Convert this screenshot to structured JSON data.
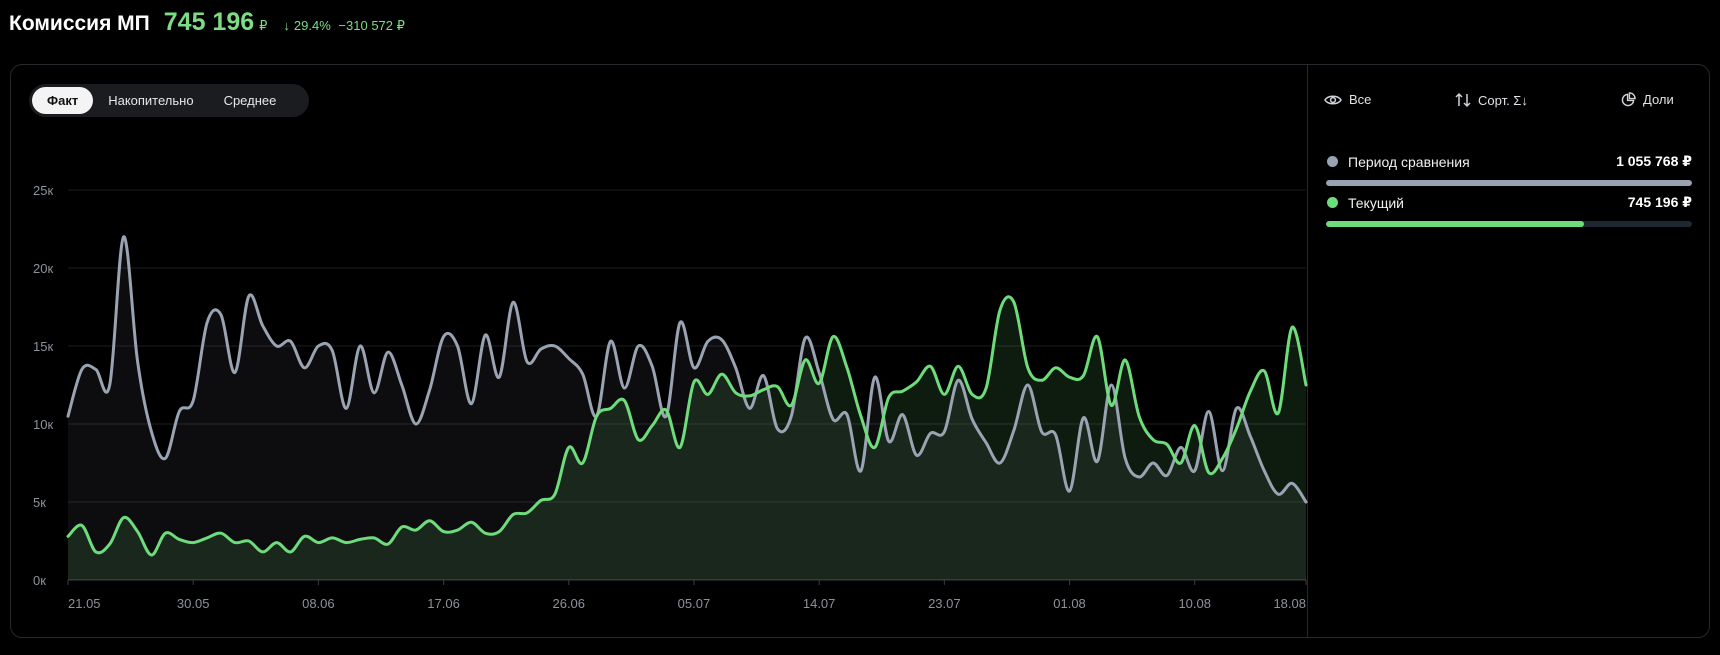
{
  "header": {
    "title": "Комиссия МП",
    "value": "745 196",
    "currency": "₽",
    "delta_percent": "29.4%",
    "delta_abs": "−310 572 ₽"
  },
  "tabs": [
    {
      "label": "Факт",
      "active": true
    },
    {
      "label": "Накопительно",
      "active": false
    },
    {
      "label": "Среднее",
      "active": false
    }
  ],
  "sidebar": {
    "all_label": "Все",
    "sort_label": "Сорт. Σ↓",
    "shares_label": "Доли",
    "legend": [
      {
        "name": "Период сравнения",
        "value": "1 055 768 ₽",
        "color": "#9aa3b2",
        "share": 1.0
      },
      {
        "name": "Текущий",
        "value": "745 196 ₽",
        "color": "#6fdc7c",
        "share": 0.706
      }
    ]
  },
  "colors": {
    "accent_green": "#7ddc86",
    "comparison_gray": "#9aa3b2"
  },
  "chart_data": {
    "type": "line",
    "ylim": [
      0,
      25000
    ],
    "y_ticks": [
      0,
      5000,
      10000,
      15000,
      20000,
      25000
    ],
    "y_tick_labels": [
      "0к",
      "5к",
      "10к",
      "15к",
      "20к",
      "25к"
    ],
    "x_tick_labels": [
      "21.05",
      "30.05",
      "08.06",
      "17.06",
      "26.06",
      "05.07",
      "14.07",
      "23.07",
      "01.08",
      "10.08",
      "18.08"
    ],
    "x_tick_index": [
      0,
      9,
      18,
      27,
      36,
      45,
      54,
      63,
      72,
      81,
      89
    ],
    "grid": true,
    "series": [
      {
        "name": "Период сравнения",
        "color": "#9aa3b2",
        "values": [
          10500,
          13500,
          13500,
          12500,
          22000,
          14000,
          9500,
          7800,
          10800,
          11500,
          16500,
          17000,
          13300,
          18200,
          16300,
          15000,
          15300,
          13600,
          15000,
          14700,
          11000,
          15000,
          12000,
          14600,
          12500,
          10000,
          12200,
          15600,
          15000,
          11300,
          15700,
          13000,
          17800,
          14000,
          14800,
          15000,
          14200,
          13200,
          10500,
          15300,
          12300,
          15000,
          13700,
          10500,
          16500,
          13600,
          15300,
          15400,
          13600,
          11000,
          13100,
          9700,
          10500,
          15500,
          13300,
          10300,
          10600,
          7000,
          13000,
          8900,
          10600,
          8000,
          9400,
          9500,
          12800,
          10300,
          8800,
          7500,
          9600,
          12500,
          9500,
          9300,
          5700,
          10400,
          7600,
          12500,
          7800,
          6600,
          7500,
          6700,
          8500,
          7000,
          10800,
          7000,
          11000,
          9200,
          7000,
          5500,
          6200,
          5000
        ]
      },
      {
        "name": "Текущий",
        "color": "#6fdc7c",
        "values": [
          2800,
          3500,
          1800,
          2300,
          4000,
          3100,
          1600,
          3000,
          2600,
          2400,
          2700,
          3000,
          2400,
          2500,
          1800,
          2400,
          1800,
          2800,
          2400,
          2700,
          2400,
          2600,
          2700,
          2300,
          3400,
          3200,
          3800,
          3100,
          3200,
          3700,
          3000,
          3100,
          4200,
          4300,
          5100,
          5500,
          8500,
          7500,
          10500,
          11000,
          11500,
          9000,
          9900,
          10900,
          8500,
          12700,
          11900,
          13200,
          12000,
          11800,
          12200,
          12400,
          11200,
          14100,
          12600,
          15600,
          13600,
          10500,
          8500,
          11700,
          12100,
          12700,
          13700,
          11900,
          13700,
          11900,
          12300,
          17300,
          17800,
          13600,
          12800,
          13600,
          13000,
          13100,
          15600,
          11200,
          14100,
          10500,
          9000,
          8700,
          7500,
          9900,
          6900,
          7800,
          9700,
          12100,
          13400,
          10700,
          16200,
          12500
        ]
      }
    ]
  }
}
